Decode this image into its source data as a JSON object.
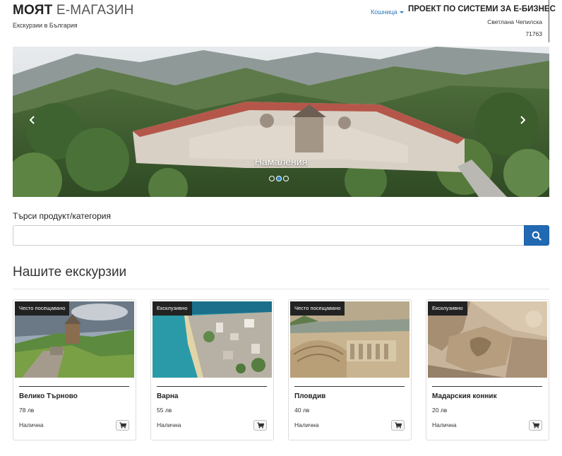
{
  "brand": {
    "title_strong": "МОЯТ",
    "title_light": "Е-МАГАЗИН",
    "subtitle": "Екскурзии в България"
  },
  "nav": {
    "cart_label": "Кошница"
  },
  "project": {
    "title": "ПРОЕКТ ПО СИСТЕМИ ЗА Е-БИЗНЕС",
    "author": "Светлана Чепилска",
    "id": "71763"
  },
  "carousel": {
    "caption": "Намаления",
    "prev_icon": "chevron-left-icon",
    "next_icon": "chevron-right-icon",
    "slide_count": 3,
    "active_slide": 2
  },
  "search": {
    "label": "Търси продукт/категория",
    "value": "",
    "placeholder": "",
    "button_icon": "search-icon",
    "accent": "#2169b3"
  },
  "section": {
    "title": "Нашите екскурзии"
  },
  "products": [
    {
      "badge": "Често посещавано",
      "name": "Велико Търново",
      "price": "78 лв",
      "stock": "Налична",
      "cart_icon": "cart-icon"
    },
    {
      "badge": "Ексклузивно",
      "name": "Варна",
      "price": "55 лв",
      "stock": "Налична",
      "cart_icon": "cart-icon"
    },
    {
      "badge": "Често посещавано",
      "name": "Пловдив",
      "price": "40 лв",
      "stock": "Налична",
      "cart_icon": "cart-icon"
    },
    {
      "badge": "Ексклузивно",
      "name": "Мадарския конник",
      "price": "20 лв",
      "stock": "Налична",
      "cart_icon": "cart-icon"
    }
  ]
}
